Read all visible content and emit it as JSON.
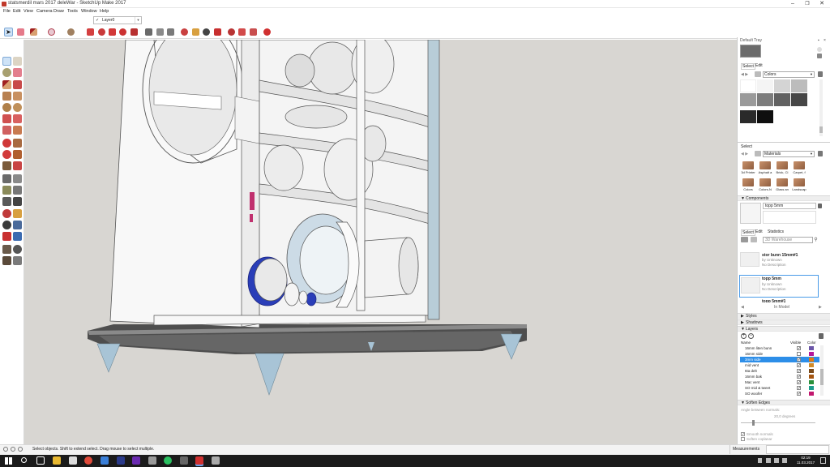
{
  "window": {
    "title": "statsmerdil mars 2017 deleWar - SketchUp Make 2017",
    "minimize": "–",
    "maximize": "❐",
    "close": "✕"
  },
  "menu": [
    "File",
    "Edit",
    "View",
    "Camera",
    "Draw",
    "Tools",
    "Window",
    "Help"
  ],
  "layer_dropdown": {
    "check": "✓",
    "value": "Layer0"
  },
  "toolbar_icons": [
    "select-icon",
    "eraser-icon",
    "pencil-icon",
    "shape-icon",
    "paint-bucket-icon",
    "push-pull-icon",
    "move-icon",
    "rotate-icon",
    "scale-icon",
    "offset-icon",
    "tape-icon",
    "text-icon",
    "paint-icon",
    "orbit-icon",
    "pan-icon",
    "zoom-icon",
    "zoom-extents-icon",
    "warehouse-icon",
    "extension-icon",
    "component-icon",
    "layout-icon"
  ],
  "tray": {
    "default_tray": "Default Tray",
    "materials_top": {
      "tabs": [
        "Select",
        "Edit"
      ],
      "collection": "Colors",
      "swatches": [
        "#ffffff",
        "#f4f4f4",
        "#d4d4d4",
        "#bcbcbc",
        "#9a9a9a",
        "#7c7c7c",
        "#616161",
        "#464646",
        "#2a2a2a",
        "#0f0f0f"
      ]
    },
    "materials_select": {
      "label": "Select",
      "collection": "Materials",
      "items": [
        "3d Printer",
        "Asphalt a",
        "Brick, Cl",
        "Carpet, f",
        "Colors",
        "Colors-N",
        "Glass an",
        "Landscap"
      ]
    },
    "components": {
      "header": "Components",
      "name": "topp 5mm",
      "tabs": [
        "Select",
        "Edit",
        "Statistics"
      ],
      "search_placeholder": "3D Warehouse",
      "items": [
        {
          "name": "stor bunn 15mm#1",
          "by": "by Unknown",
          "desc": "No Description"
        },
        {
          "name": "topp 5mm",
          "by": "by Unknown",
          "desc": "No Description"
        },
        {
          "name": "topp 5mm#1",
          "by": "",
          "desc": ""
        }
      ],
      "footer": "In Model"
    },
    "sections": [
      "Styles",
      "Shadows",
      "Layers"
    ],
    "layers": {
      "columns": [
        "Name",
        "Visible",
        "Color"
      ],
      "rows": [
        {
          "name": "16mm liten bunn",
          "visible": "✓",
          "color": "#6b56a8"
        },
        {
          "name": "16mm side",
          "visible": "",
          "color": "#b5189b"
        },
        {
          "name": "3mm side",
          "visible": "✓",
          "color": "#e07a12",
          "selected": true
        },
        {
          "name": "mid vent",
          "visible": "✓",
          "color": "#d08a2a"
        },
        {
          "name": "6ta delt",
          "visible": "✓",
          "color": "#7a4a1a"
        },
        {
          "name": "16mm bak",
          "visible": "✓",
          "color": "#a4540f"
        },
        {
          "name": "Mac vent",
          "visible": "✓",
          "color": "#2a8f3a"
        },
        {
          "name": "SO mid & tweet",
          "visible": "✓",
          "color": "#1c9c8c"
        },
        {
          "name": "SO woofer",
          "visible": "✓",
          "color": "#c2186f"
        }
      ]
    },
    "soften": {
      "header": "Soften Edges",
      "angle_label": "Angle between normals:",
      "angle_value": "20,0 degrees",
      "smooth": "Smooth normals",
      "coplanar": "Soften coplanar"
    }
  },
  "status": {
    "message": "Select objects. Shift to extend select. Drag mouse to select multiple.",
    "measurements_label": "Measurements"
  },
  "taskbar": {
    "time": "02:19",
    "date": "11.03.2017"
  }
}
